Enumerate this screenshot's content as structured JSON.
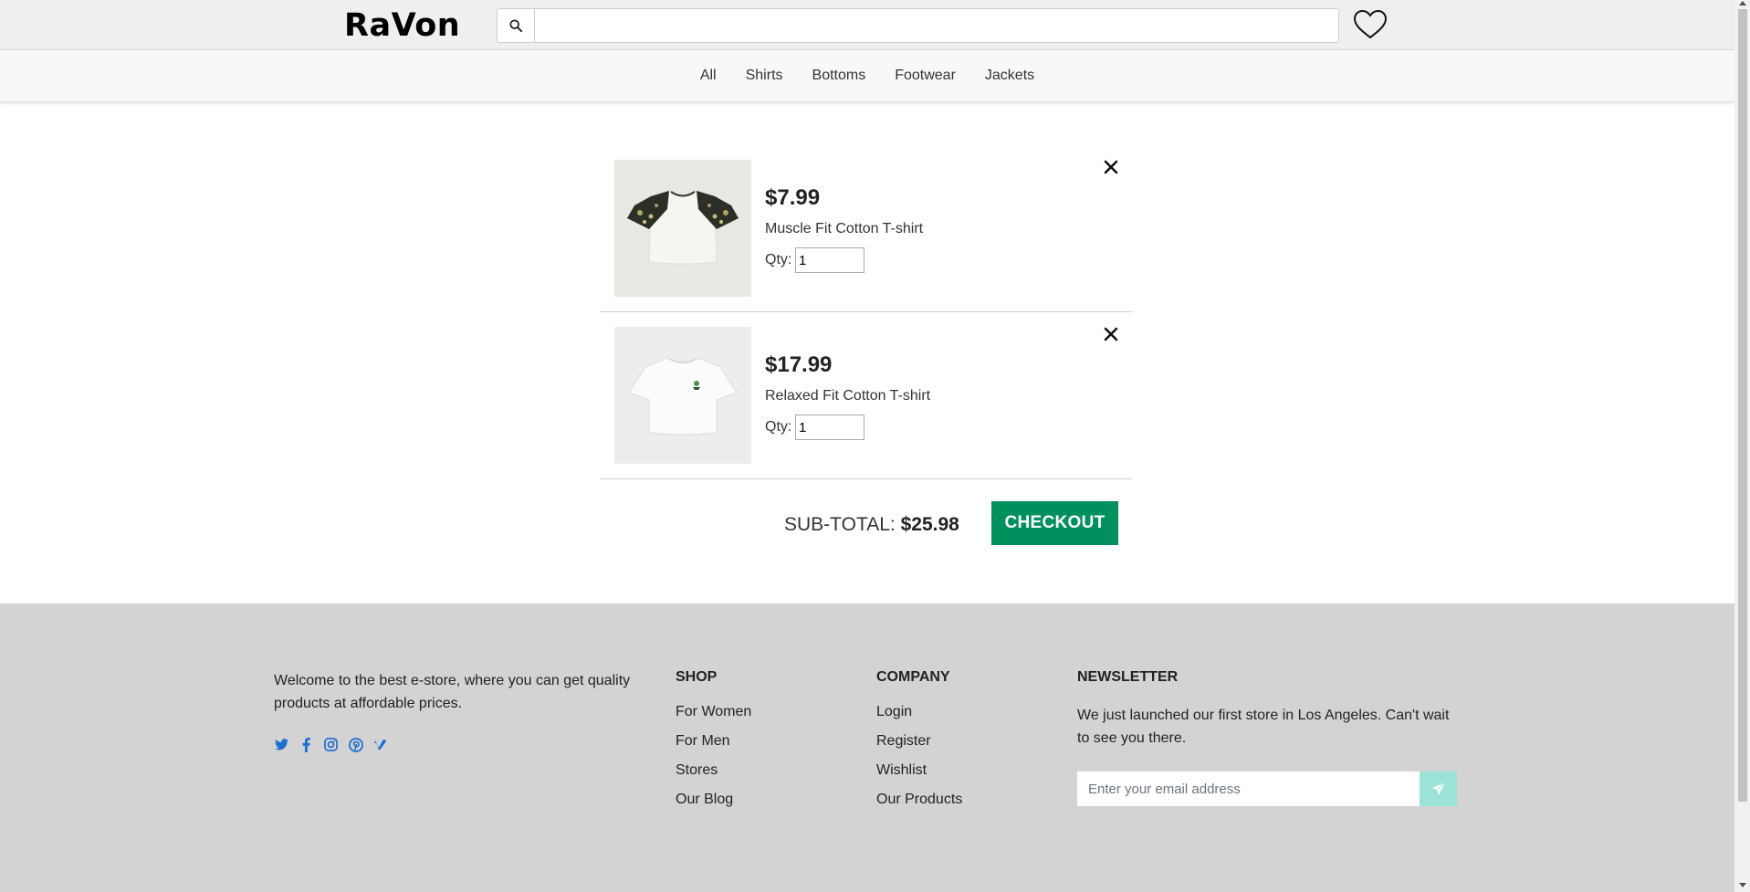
{
  "header": {
    "logo": "RaVon",
    "search": {
      "icon": "search-icon",
      "value": "",
      "placeholder": ""
    },
    "wishlist_icon": "heart-icon"
  },
  "nav": {
    "categories": [
      "All",
      "Shirts",
      "Bottoms",
      "Footwear",
      "Jackets"
    ]
  },
  "cart": {
    "items": [
      {
        "price": "$7.99",
        "name": "Muscle Fit Cotton T-shirt",
        "qty_label": "Qty:",
        "qty": "1",
        "image": "t-shirt-camo-sleeves"
      },
      {
        "price": "$17.99",
        "name": "Relaxed Fit Cotton T-shirt",
        "qty_label": "Qty:",
        "qty": "1",
        "image": "t-shirt-white"
      }
    ],
    "subtotal_label": "SUB-TOTAL:",
    "subtotal_value": "$25.98",
    "checkout_label": "CHECKOUT"
  },
  "footer": {
    "about": "Welcome to the best e-store, where you can get quality products at affordable prices.",
    "social_icons": [
      "twitter-icon",
      "facebook-icon",
      "instagram-icon",
      "pinterest-icon",
      "vimeo-icon"
    ],
    "shop": {
      "title": "SHOP",
      "links": [
        "For Women",
        "For Men",
        "Stores",
        "Our Blog"
      ]
    },
    "company": {
      "title": "COMPANY",
      "links": [
        "Login",
        "Register",
        "Wishlist",
        "Our Products"
      ]
    },
    "newsletter": {
      "title": "NEWSLETTER",
      "text": "We just launched our first store in Los Angeles. Can't wait to see you there.",
      "placeholder": "Enter your email address",
      "send_icon": "paper-plane-icon"
    }
  },
  "colors": {
    "checkout": "#00905d",
    "social": "#1d6fd1",
    "newsletter_button": "#9be3d6",
    "footer_bg": "#d3d3d3"
  }
}
